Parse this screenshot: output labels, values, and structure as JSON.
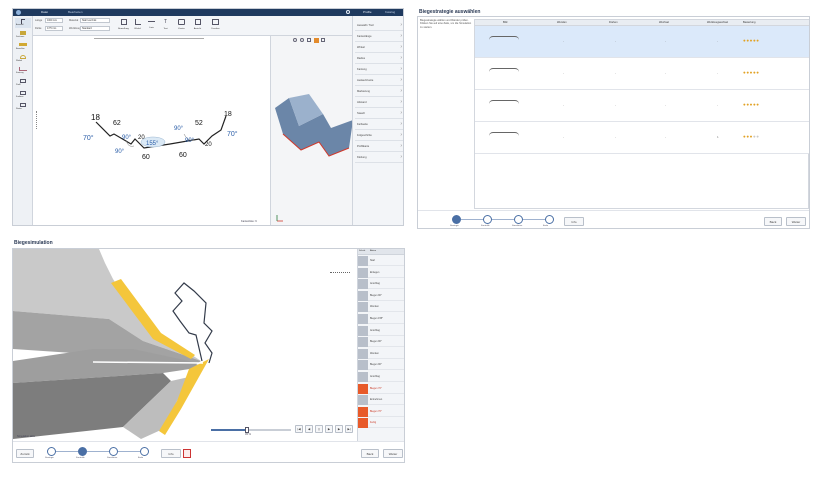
{
  "editor": {
    "menu": [
      "Datei",
      "Bearbeiten",
      "Ansicht"
    ],
    "right_tabs": [
      "Profile",
      "Katalog"
    ],
    "field_labels": [
      "Länge",
      "Material",
      "Dicke",
      "Werkzeug"
    ],
    "field_values": [
      "1000 mm",
      "Stahl verzinkt",
      "0.75 mm",
      "Standard"
    ],
    "tool_labels": [
      "Bemaßung",
      "Winkel",
      "Linie",
      "Text",
      "Kontur",
      "Ansicht",
      "Drucken"
    ],
    "left_tools": [
      "Auswahl",
      "Zeichnen",
      "Bemaßen",
      "Winkel",
      "Kantung",
      "Profil",
      "Freiform",
      "Raster"
    ],
    "dims": {
      "l18a": "18",
      "l62": "62",
      "l52": "52",
      "l18b": "18",
      "a70a": "70°",
      "a70b": "70°",
      "l20a": "20",
      "l20b": "20",
      "a90a": "90°",
      "a90b": "90°",
      "a90c": "90°",
      "a90d": "90°",
      "a155": "155°",
      "l60a": "60",
      "l60b": "60"
    },
    "view_label": "Kantenliste: 9",
    "property_items": [
      "Auswahl / Tool",
      "Kantenlänge",
      "Winkel",
      "Radius",
      "Kantung",
      "Auslauf-Kante",
      "Markierung",
      "Abstand",
      "Stauch",
      "Farbseite",
      "Folgeschritte",
      "Profilkante",
      "Klebung"
    ],
    "property_values": [
      "",
      "",
      "",
      "",
      "",
      "",
      "",
      "",
      "",
      "",
      "",
      "",
      ""
    ]
  },
  "strategy": {
    "title": "Biegestrategie auswählen",
    "hint": "Biegestrategie wählen und Ränder prüfen. Klicken Sie auf eine Zeile, um die Simulation zu starten.",
    "columns": [
      "Bild",
      "Wenden",
      "Drehen",
      "Wechsel",
      "Werkzeugwechsel",
      "Bewertung"
    ],
    "rows": [
      {
        "flip": "-",
        "rotate": "-",
        "change": "-",
        "tool": "-",
        "rating": 5,
        "selected": true
      },
      {
        "flip": "-",
        "rotate": "-",
        "change": "-",
        "tool": "-",
        "rating": 5,
        "selected": false
      },
      {
        "flip": "-",
        "rotate": "-",
        "change": "-",
        "tool": "-",
        "rating": 5,
        "selected": false
      },
      {
        "flip": "-",
        "rotate": "-",
        "change": "-",
        "tool": "1",
        "rating": 3,
        "selected": false
      }
    ],
    "steps": [
      "Strategie",
      "Kontrolle",
      "Simulation",
      "Ende"
    ],
    "mid_button": "Info",
    "back_button": "Back",
    "next_button": "Weiter"
  },
  "simulation": {
    "title": "Biegesimulation",
    "list_header": [
      "Schritt",
      "Aktion"
    ],
    "steps": [
      "Start",
      "Einlegen",
      "Anschlag",
      "Biegen 90°",
      "Wenden",
      "Biegen 155°",
      "Anschlag",
      "Biegen 90°",
      "Wenden",
      "Biegen 90°",
      "Anschlag",
      "Biegen 70°",
      "Entnehmen",
      "Biegen 70°",
      "Fertig"
    ],
    "warn_steps": [
      11,
      13,
      14
    ],
    "status": "Simulation aktiv",
    "progress_label": "45 %",
    "progress": 0.45,
    "buttons": [
      "Zurück",
      "Info"
    ],
    "steps_nav": [
      "Strategie",
      "Kontrolle",
      "Simulation",
      "Ende"
    ],
    "back_button": "Back",
    "next_button": "Weiter"
  }
}
